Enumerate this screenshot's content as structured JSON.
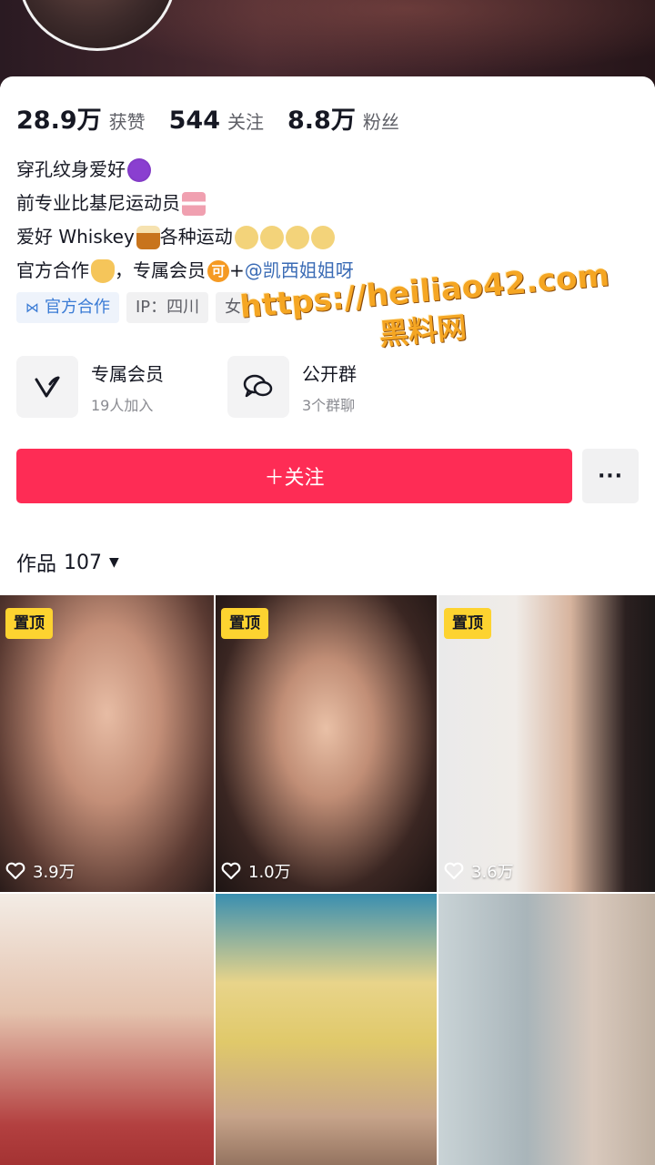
{
  "profile": {
    "stats": [
      {
        "value": "28.9万",
        "label": "获赞"
      },
      {
        "value": "544",
        "label": "关注"
      },
      {
        "value": "8.8万",
        "label": "粉丝"
      }
    ],
    "bio": {
      "line1": "穿孔纹身爱好",
      "line2": "前专业比基尼运动员",
      "line3a": "爱好 Whiskey",
      "line3b": "各种运动",
      "line4a": "官方合作",
      "line4b": "，专属会员",
      "line4_member_badge": "可",
      "line4c": "+",
      "line4_mention": "@凯西姐姐呀"
    },
    "tags": {
      "official": "官方合作",
      "ip": "IP：四川",
      "gender": "女"
    },
    "features": [
      {
        "title": "专属会员",
        "sub": "19人加入",
        "icon": "v-logo-icon"
      },
      {
        "title": "公开群",
        "sub": "3个群聊",
        "icon": "chat-bubbles-icon"
      }
    ],
    "follow_label": "＋关注",
    "more_label": "···"
  },
  "works": {
    "label": "作品",
    "count": "107",
    "tiles": [
      {
        "pinned": "置顶",
        "likes": "3.9万"
      },
      {
        "pinned": "置顶",
        "likes": "1.0万"
      },
      {
        "pinned": "置顶",
        "likes": "3.6万"
      },
      {
        "pinned": "",
        "likes": ""
      },
      {
        "pinned": "",
        "likes": ""
      },
      {
        "pinned": "",
        "likes": ""
      }
    ]
  },
  "watermark": {
    "url": "https://heiliao42.com",
    "name": "黑料网"
  },
  "colors": {
    "follow": "#fe2c55",
    "pin_badge": "#fdd330",
    "mention": "#3a6bb5",
    "watermark": "#f5a623"
  }
}
